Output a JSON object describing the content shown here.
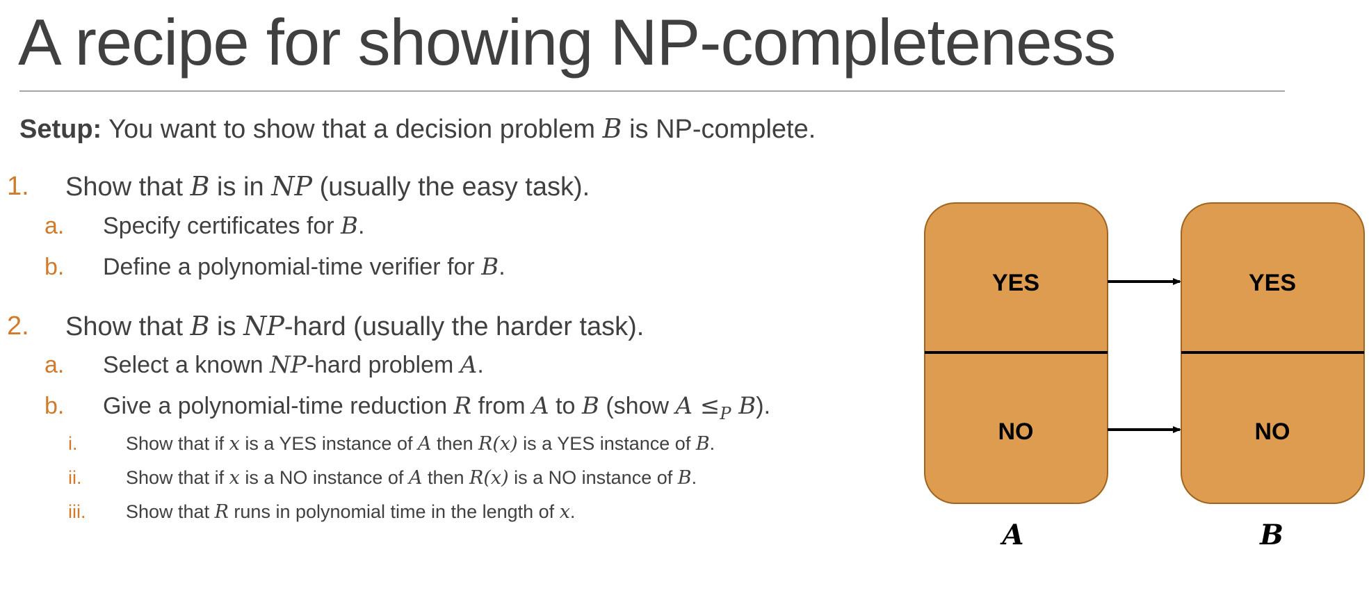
{
  "title": "A recipe for showing NP-completeness",
  "setup": {
    "label": "Setup:",
    "pre": " You want to show that a decision problem ",
    "var": "B",
    "post": " is NP-complete."
  },
  "steps": [
    {
      "num": "1.",
      "parts": [
        "Show that ",
        "B",
        " is in ",
        "NP",
        " (usually the easy task)."
      ],
      "sub": [
        {
          "num": "a.",
          "parts": [
            "Specify certificates for ",
            "B",
            "."
          ]
        },
        {
          "num": "b.",
          "parts": [
            "Define a polynomial-time verifier for ",
            "B",
            "."
          ]
        }
      ]
    },
    {
      "num": "2.",
      "parts": [
        "Show that ",
        "B",
        " is ",
        "NP",
        "-hard (usually the harder task)."
      ],
      "sub": [
        {
          "num": "a.",
          "parts": [
            "Select a known ",
            "NP",
            "-hard problem ",
            "A",
            "."
          ]
        },
        {
          "num": "b.",
          "parts": [
            "Give a polynomial-time reduction ",
            "R",
            " from ",
            "A",
            " to ",
            "B",
            " (show ",
            "A ≤",
            "P",
            " B",
            ")."
          ],
          "sub": [
            {
              "num": "i.",
              "parts": [
                "Show that if ",
                "x",
                " is a YES instance of ",
                "A",
                " then ",
                "R(x)",
                " is a YES instance of ",
                "B",
                "."
              ]
            },
            {
              "num": "ii.",
              "parts": [
                "Show that if ",
                "x",
                " is a NO instance of ",
                "A",
                " then ",
                "R(x)",
                " is a NO instance of ",
                "B",
                "."
              ]
            },
            {
              "num": "iii.",
              "parts": [
                "Show that ",
                "R",
                " runs in polynomial time in the length of ",
                "x",
                "."
              ]
            }
          ]
        }
      ]
    }
  ],
  "diagram": {
    "left_box": {
      "yes": "YES",
      "no": "NO",
      "label": "A"
    },
    "right_box": {
      "yes": "YES",
      "no": "NO",
      "label": "B"
    },
    "colors": {
      "fill": "#dd9c50",
      "stroke": "#a0641e",
      "accent": "#d07a2a",
      "text": "#404040"
    }
  }
}
